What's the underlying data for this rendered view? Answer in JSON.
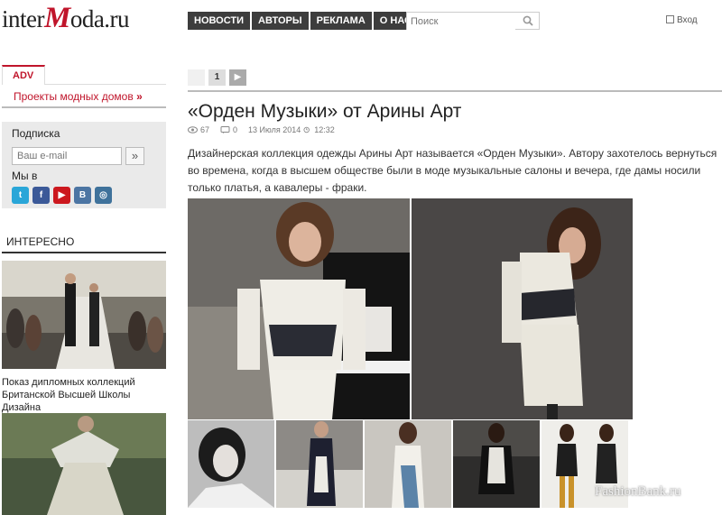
{
  "logo": {
    "part1": "inter",
    "part2": "M",
    "part3": "oda.ru"
  },
  "nav": [
    "НОВОСТИ",
    "АВТОРЫ",
    "РЕКЛАМА",
    "О НАС"
  ],
  "search": {
    "placeholder": "Поиск"
  },
  "login": "Вход",
  "sidebar": {
    "adv_tab": "ADV",
    "adv_link": "Проекты модных домов",
    "adv_arrow": "»",
    "subscribe_title": "Подписка",
    "email_placeholder": "Ваш e-mail",
    "subscribe_button": "»",
    "we_in": "Мы в",
    "socials": [
      {
        "name": "twitter-icon",
        "glyph": "t",
        "color": "#2aa6d8"
      },
      {
        "name": "facebook-icon",
        "glyph": "f",
        "color": "#3b5998"
      },
      {
        "name": "youtube-icon",
        "glyph": "▶",
        "color": "#cc181e"
      },
      {
        "name": "vkontakte-icon",
        "glyph": "В",
        "color": "#4c75a3"
      },
      {
        "name": "instagram-icon",
        "glyph": "◎",
        "color": "#3f729b"
      }
    ],
    "interesting_heading": "ИНТЕРЕСНО",
    "article_caption": "Показ дипломных коллекций Британской Высшей Школы Дизайна"
  },
  "pager": {
    "current": "1"
  },
  "article": {
    "title": "«Орден Музыки» от Арины Арт",
    "views": "67",
    "comments": "0",
    "date": "13 Июля 2014",
    "time": "12:32",
    "lead": "Дизайнерская коллекция одежды Арины Арт называется «Орден Музыки». Автору захотелось вернуться во времена, когда в высшем обществе были в моде музыкальные салоны и вечера, где дамы носили только платья, а кавалеры - фраки."
  },
  "watermark": "FashionBank.ru",
  "colors": {
    "accent": "#c0152b",
    "nav_bg": "#3d3d3d"
  }
}
